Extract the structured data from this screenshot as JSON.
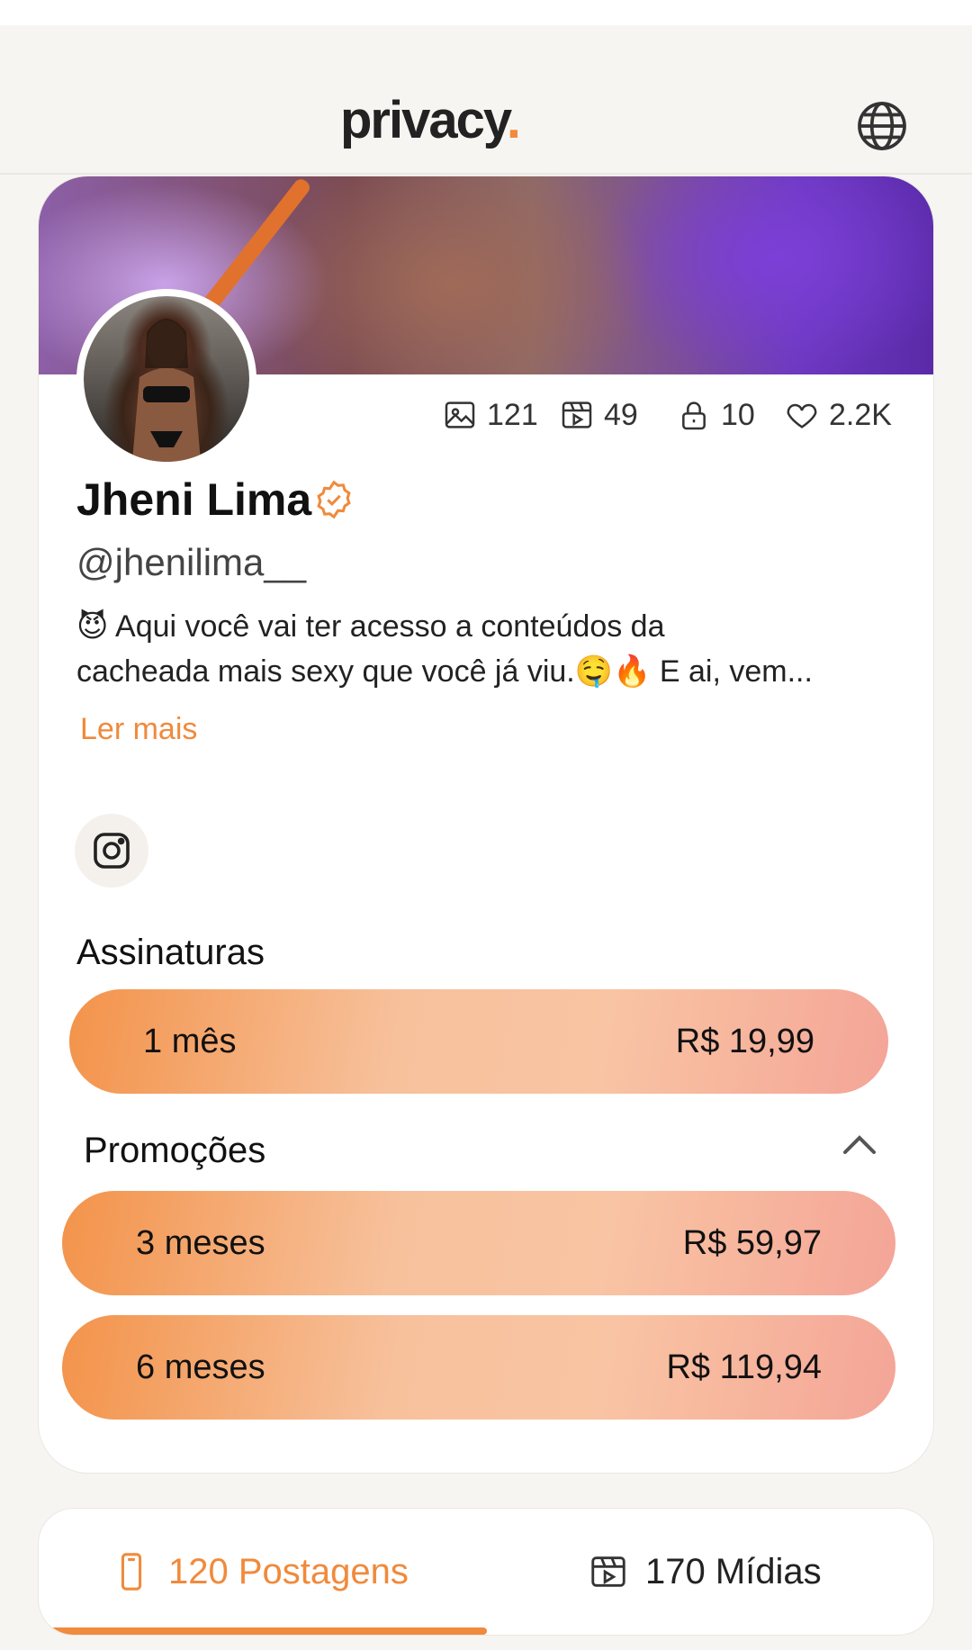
{
  "header": {
    "logo_text": "privacy",
    "logo_dot": ".",
    "language_icon": "globe-icon"
  },
  "profile": {
    "name": "Jheni Lima",
    "handle": "@jhenilima__",
    "verified_icon": "verified-badge-icon",
    "stats": {
      "photos": "121",
      "videos": "49",
      "locked": "10",
      "likes": "2.2K"
    },
    "bio_line1": "😈 Aqui você vai ter acesso a conteúdos da",
    "bio_line2": "cacheada mais sexy que você já viu.🤤🔥 E ai, vem...",
    "read_more": "Ler mais",
    "social_icon": "instagram-icon"
  },
  "subscriptions": {
    "title": "Assinaturas",
    "main": {
      "label": "1 mês",
      "price": "R$ 19,99"
    },
    "promotions_title": "Promoções",
    "promotions": [
      {
        "label": "3 meses",
        "price": "R$ 59,97"
      },
      {
        "label": "6 meses",
        "price": "R$ 119,94"
      }
    ]
  },
  "tabs": [
    {
      "label": "120 Postagens",
      "active": true
    },
    {
      "label": "170 Mídias",
      "active": false
    }
  ],
  "colors": {
    "accent": "#f08a3c",
    "background": "#f7f5f2",
    "card": "#ffffff"
  }
}
